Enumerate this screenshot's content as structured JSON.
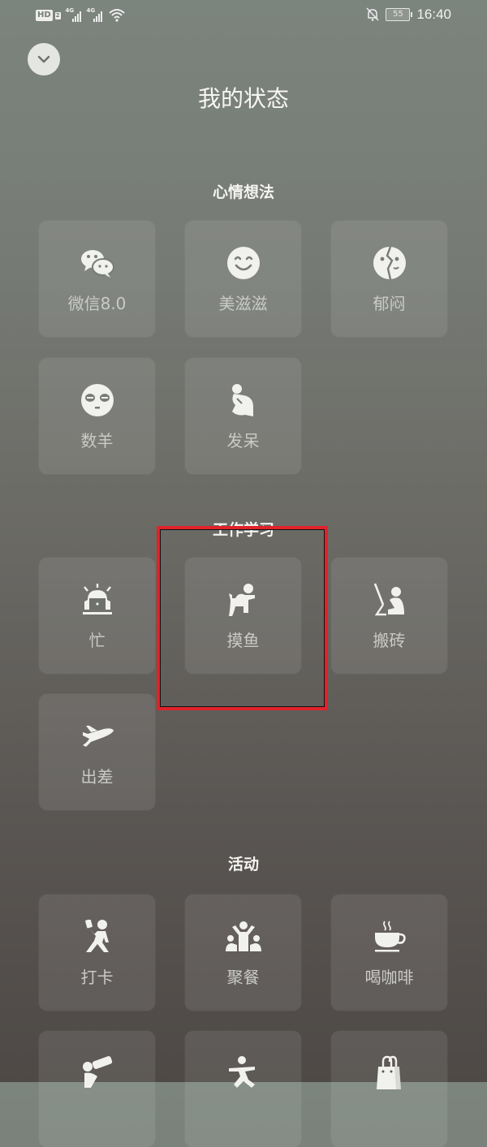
{
  "status_bar": {
    "hd_label": "HD",
    "hd_sub": "2",
    "sim1_label": "4G",
    "sim2_label": "4G",
    "battery_level": "55",
    "time": "16:40",
    "icons": [
      "hd-icon",
      "signal-icon",
      "signal-icon",
      "wifi-icon",
      "bell-off-icon",
      "battery-icon"
    ]
  },
  "header": {
    "back_icon": "chevron-down-icon",
    "title": "我的状态"
  },
  "sections": [
    {
      "title": "心情想法",
      "items": [
        {
          "label": "微信8.0",
          "icon": "wechat-icon"
        },
        {
          "label": "美滋滋",
          "icon": "smile-face-icon"
        },
        {
          "label": "郁闷",
          "icon": "broken-face-icon"
        },
        {
          "label": "数羊",
          "icon": "sleepy-face-icon"
        },
        {
          "label": "发呆",
          "icon": "thinker-icon"
        }
      ]
    },
    {
      "title": "工作学习",
      "items": [
        {
          "label": "忙",
          "icon": "alarm-laptop-icon"
        },
        {
          "label": "摸鱼",
          "icon": "toilet-person-icon"
        },
        {
          "label": "搬砖",
          "icon": "desk-worker-icon"
        },
        {
          "label": "出差",
          "icon": "airplane-icon"
        }
      ]
    },
    {
      "title": "活动",
      "items": [
        {
          "label": "打卡",
          "icon": "selfie-walker-icon"
        },
        {
          "label": "聚餐",
          "icon": "group-cheer-icon"
        },
        {
          "label": "喝咖啡",
          "icon": "coffee-cup-icon"
        },
        {
          "label": "",
          "icon": "drinking-icon"
        },
        {
          "label": "",
          "icon": "exercise-icon"
        },
        {
          "label": "",
          "icon": "shopping-bag-icon"
        }
      ]
    }
  ],
  "highlight": {
    "target": "摸鱼",
    "color": "#e0222a"
  }
}
